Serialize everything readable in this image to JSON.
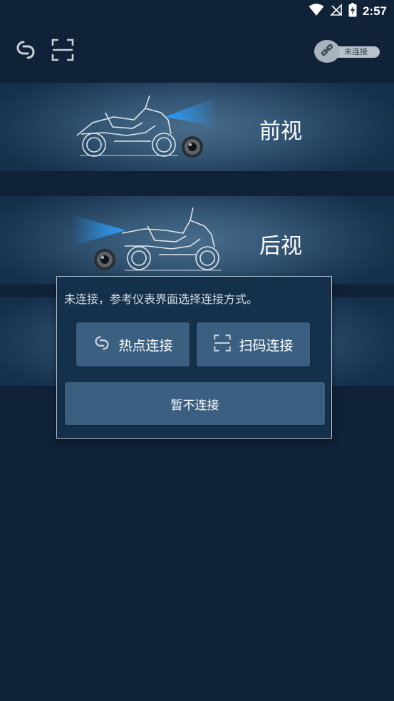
{
  "status_bar": {
    "time": "2:57",
    "icons": [
      "wifi-icon",
      "no-signal-icon",
      "battery-charging-icon"
    ]
  },
  "toolbar": {
    "hotspot_icon": "link-ring-icon",
    "scan_icon": "scan-frame-icon",
    "connection_status": "未连接",
    "connection_icon": "link-chain-icon"
  },
  "views": [
    {
      "label": "前视",
      "illustration": "motorcycle-front-camera"
    },
    {
      "label": "后视",
      "illustration": "motorcycle-rear-camera"
    }
  ],
  "dialog": {
    "message": "未连接，参考仪表界面选择连接方式。",
    "hotspot_button": "热点连接",
    "scan_button": "扫码连接",
    "later_button": "暂不连接"
  },
  "colors": {
    "background": "#0f2238",
    "card_highlight": "#4a6c8b",
    "button": "#3a5f80",
    "camera_beam": "#1e8fff"
  }
}
